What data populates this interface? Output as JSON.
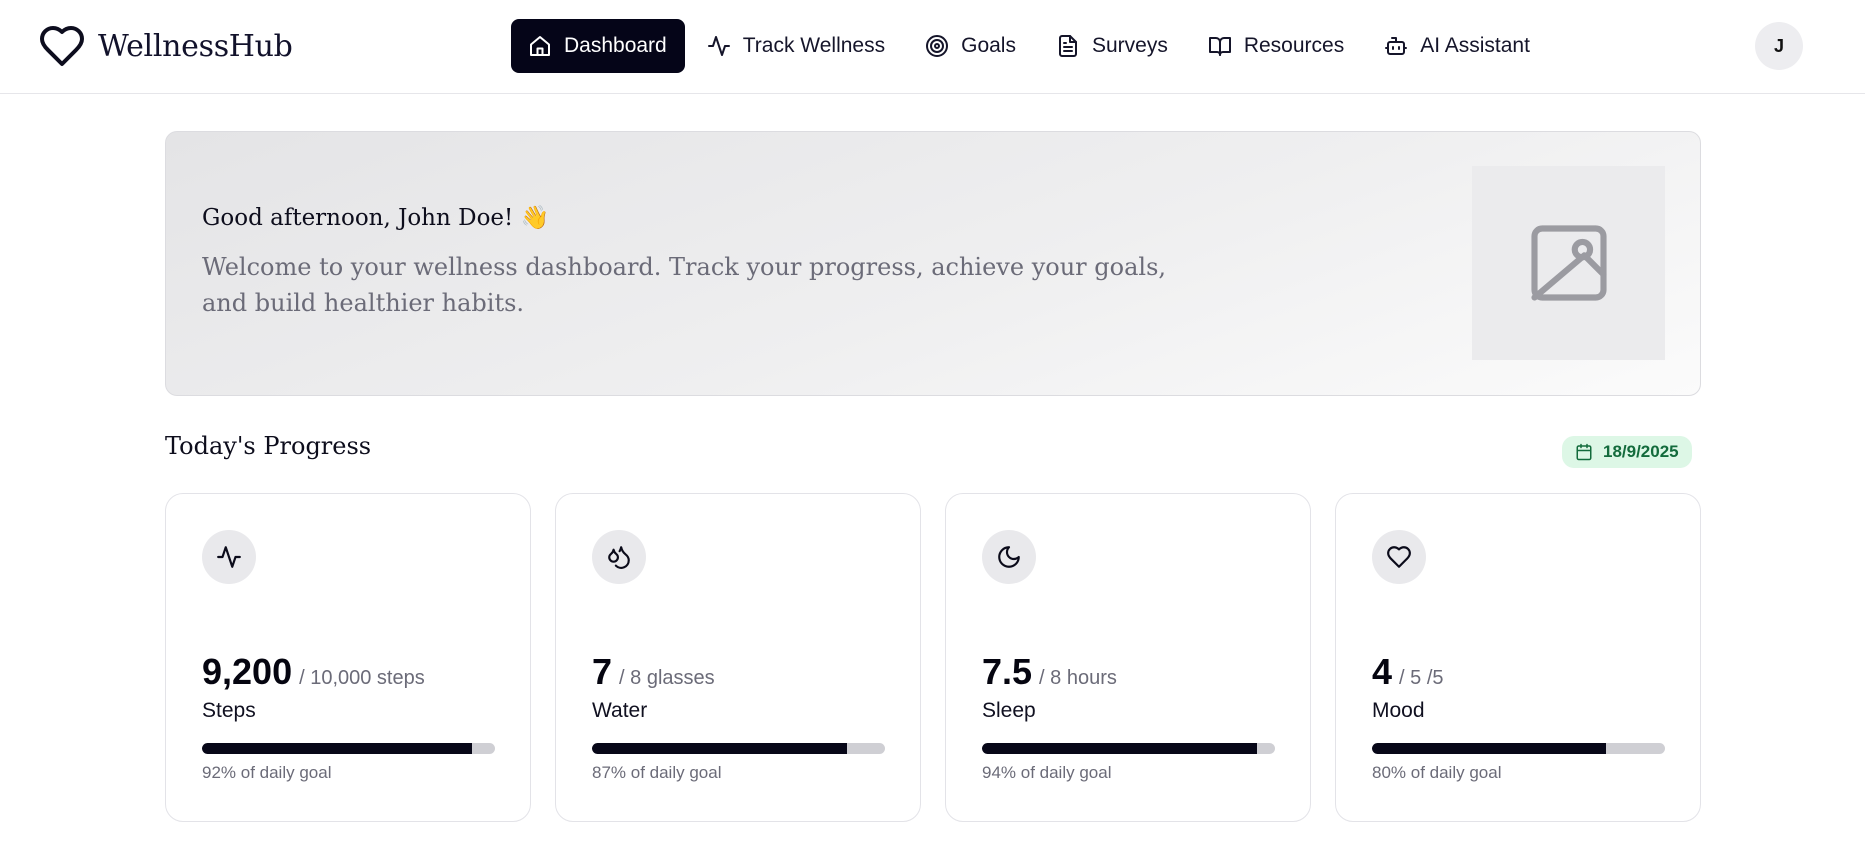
{
  "header": {
    "brand_name": "WellnessHub",
    "brand_icon": "heart-icon",
    "nav": [
      {
        "label": "Dashboard",
        "icon": "home-icon",
        "active": true
      },
      {
        "label": "Track Wellness",
        "icon": "activity-icon",
        "active": false
      },
      {
        "label": "Goals",
        "icon": "target-icon",
        "active": false
      },
      {
        "label": "Surveys",
        "icon": "document-icon",
        "active": false
      },
      {
        "label": "Resources",
        "icon": "book-icon",
        "active": false
      },
      {
        "label": "AI Assistant",
        "icon": "bot-icon",
        "active": false
      }
    ],
    "avatar_initial": "J"
  },
  "hero": {
    "greeting": "Good afternoon, John Doe! 👋",
    "subtitle": "Welcome to your wellness dashboard. Track your progress, achieve your goals, and build healthier habits.",
    "image_icon": "image-placeholder-icon"
  },
  "progress_section": {
    "title": "Today's Progress",
    "date": "18/9/2025",
    "date_icon": "calendar-icon"
  },
  "metrics": [
    {
      "icon": "activity-icon",
      "value": "9,200",
      "target": "/ 10,000 steps",
      "label": "Steps",
      "percent": 92,
      "caption": "92% of daily goal"
    },
    {
      "icon": "droplets-icon",
      "value": "7",
      "target": "/ 8 glasses",
      "label": "Water",
      "percent": 87,
      "caption": "87% of daily goal"
    },
    {
      "icon": "moon-icon",
      "value": "7.5",
      "target": "/ 8 hours",
      "label": "Sleep",
      "percent": 94,
      "caption": "94% of daily goal"
    },
    {
      "icon": "heart-icon",
      "value": "4",
      "target": "/ 5 /5",
      "label": "Mood",
      "percent": 80,
      "caption": "80% of daily goal"
    }
  ],
  "colors": {
    "primary": "#050518",
    "badge_bg": "#ddf7e6",
    "badge_text": "#136b3c",
    "muted_text": "#6b6b78"
  }
}
